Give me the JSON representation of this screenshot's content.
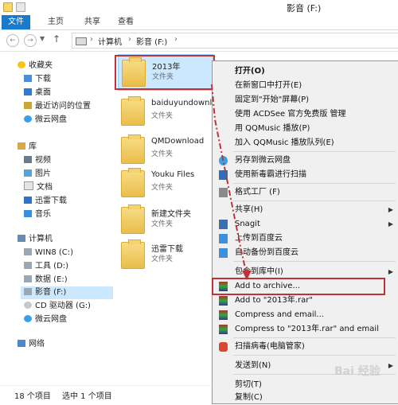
{
  "window": {
    "title": "影音 (F:)"
  },
  "ribbon": {
    "tabs": [
      "文件",
      "主页",
      "共享",
      "查看"
    ]
  },
  "address": {
    "segments": [
      "计算机",
      "影音 (F:)"
    ]
  },
  "navpane": {
    "favorites": [
      "收藏夹",
      "下载",
      "桌面",
      "最近访问的位置",
      "微云网盘"
    ],
    "library": [
      "库",
      "视频",
      "图片",
      "文档",
      "迅雷下载",
      "音乐"
    ],
    "computer": [
      "计算机",
      "WIN8 (C:)",
      "工具 (D:)",
      "数据 (E:)",
      "影音 (F:)",
      "CD 驱动器 (G:)",
      "微云网盘"
    ],
    "network": "网络"
  },
  "files": [
    {
      "name": "2013年",
      "type": "文件夹"
    },
    {
      "name": "baiduyundownlo",
      "type": "文件夹"
    },
    {
      "name": "QMDownload",
      "type": "文件夹"
    },
    {
      "name": "Youku Files",
      "type": "文件夹"
    },
    {
      "name": "新建文件夹",
      "type": "文件夹"
    },
    {
      "name": "迅雷下载",
      "type": "文件夹"
    }
  ],
  "menu": [
    {
      "label": "打开(O)"
    },
    {
      "label": "在新窗口中打开(E)"
    },
    {
      "label": "固定到\"开始\"屏幕(P)"
    },
    {
      "label": "使用 ACDSee 官方免费版 管理"
    },
    {
      "label": "用 QQMusic 播放(P)"
    },
    {
      "label": "加入 QQMusic 播放队列(E)"
    },
    {
      "label": "另存到微云网盘"
    },
    {
      "label": "使用新毒霸进行扫描"
    },
    {
      "label": "格式工厂 (F)"
    },
    {
      "label": "共享(H)"
    },
    {
      "label": "Snagit"
    },
    {
      "label": "上传到百度云"
    },
    {
      "label": "自动备份到百度云"
    },
    {
      "label": "包含到库中(I)"
    },
    {
      "label": "Add to archive..."
    },
    {
      "label": "Add to \"2013年.rar\""
    },
    {
      "label": "Compress and email..."
    },
    {
      "label": "Compress to \"2013年.rar\" and email"
    },
    {
      "label": "扫描病毒(电脑管家)"
    },
    {
      "label": "发送到(N)"
    },
    {
      "label": "剪切(T)"
    },
    {
      "label": "复制(C)"
    }
  ],
  "status": {
    "count": "18 个项目",
    "selected": "选中 1 个项目"
  },
  "watermark": "Bai 经验"
}
